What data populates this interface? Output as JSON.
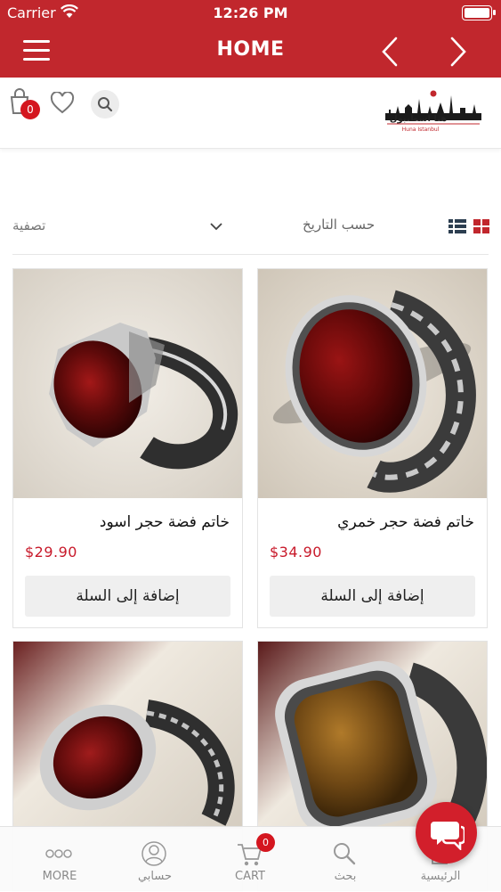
{
  "status_bar": {
    "carrier": "Carrier",
    "time": "12:26 PM"
  },
  "navbar": {
    "title": "HOME"
  },
  "header": {
    "cart_count": "0",
    "logo_text": "هنا اسطنبول",
    "logo_subtext": "Huna Istanbul"
  },
  "toolbar": {
    "filter_label": "تصفية",
    "sort_label": "حسب التاريخ"
  },
  "products": [
    {
      "name": "خاتم فضة حجر خمري",
      "price": "$34.90",
      "button": "إضافة إلى السلة"
    },
    {
      "name": "خاتم فضة حجر اسود",
      "price": "$29.90",
      "button": "إضافة إلى السلة"
    },
    {
      "name": "",
      "price": "",
      "button": ""
    },
    {
      "name": "",
      "price": "",
      "button": ""
    }
  ],
  "bottom_nav": {
    "home": "الرئيسية",
    "search": "بحث",
    "cart": "CART",
    "cart_count": "0",
    "account": "حسابي",
    "more": "MORE"
  },
  "colors": {
    "brand": "#c1272d",
    "price": "#c8192a",
    "badge": "#d4161f"
  },
  "icons": [
    "menu-icon",
    "chevron-left-icon",
    "chevron-right-icon",
    "cart-icon",
    "heart-icon",
    "search-icon",
    "list-view-icon",
    "grid-view-icon",
    "chat-icon",
    "more-icon",
    "user-icon",
    "home-icon"
  ]
}
